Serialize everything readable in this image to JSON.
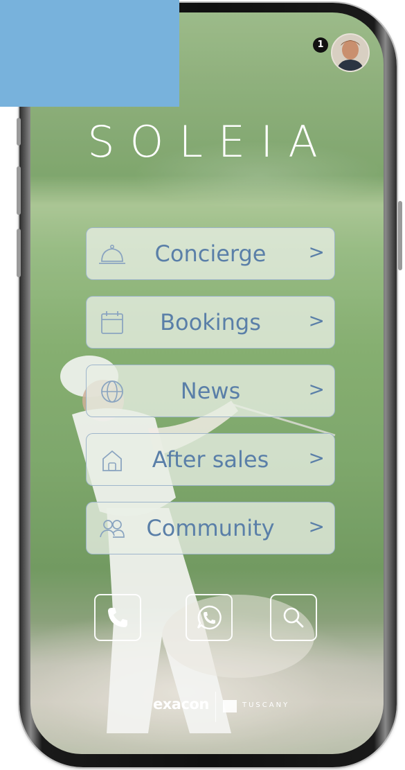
{
  "header": {
    "notification_count": "1"
  },
  "brand": {
    "logo_text": "SOLEIA"
  },
  "menu": [
    {
      "label": "Concierge",
      "icon": "bell-icon",
      "chevron": ">"
    },
    {
      "label": "Bookings",
      "icon": "calendar-icon",
      "chevron": ">"
    },
    {
      "label": "News",
      "icon": "globe-icon",
      "chevron": ">"
    },
    {
      "label": "After sales",
      "icon": "home-icon",
      "chevron": ">"
    },
    {
      "label": "Community",
      "icon": "people-icon",
      "chevron": ">"
    }
  ],
  "actions": [
    {
      "name": "phone",
      "icon": "phone-icon"
    },
    {
      "name": "whatsapp",
      "icon": "whatsapp-icon"
    },
    {
      "name": "search",
      "icon": "search-icon"
    }
  ],
  "footer": {
    "partner_1": "exacon",
    "partner_2": "TUSCANY"
  },
  "colors": {
    "menu_text": "#5a7fa8",
    "overlay_blue": "#78b2dc",
    "menu_background": "#e8eee4"
  }
}
